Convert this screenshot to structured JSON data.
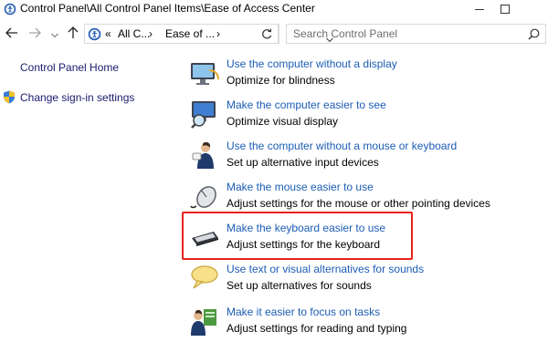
{
  "window": {
    "title": "Control Panel\\All Control Panel Items\\Ease of Access Center",
    "app_icon": "ease-of-access-icon"
  },
  "window_controls": {
    "minimize_icon": "minimize-icon",
    "maximize_icon": "maximize-icon"
  },
  "nav": {
    "back_icon": "back-arrow-icon",
    "forward_icon": "forward-arrow-icon",
    "up_icon": "up-arrow-icon"
  },
  "address": {
    "prefix": "«",
    "segments": [
      "All C...",
      "Ease of ..."
    ],
    "refresh_icon": "refresh-icon"
  },
  "search": {
    "placeholder": "Search Control Panel"
  },
  "sidebar": {
    "home_label": "Control Panel Home",
    "signin_label": "Change sign-in settings"
  },
  "items": [
    {
      "link": "Use the computer without a display",
      "desc": "Optimize for blindness",
      "icon": "display-narrator-icon"
    },
    {
      "link": "Make the computer easier to see",
      "desc": "Optimize visual display",
      "icon": "monitor-magnifier-icon"
    },
    {
      "link": "Use the computer without a mouse or keyboard",
      "desc": "Set up alternative input devices",
      "icon": "person-speech-icon"
    },
    {
      "link": "Make the mouse easier to use",
      "desc": "Adjust settings for the mouse or other pointing devices",
      "icon": "mouse-icon"
    },
    {
      "link": "Make the keyboard easier to use",
      "desc": "Adjust settings for the keyboard",
      "icon": "keyboard-icon"
    },
    {
      "link": "Use text or visual alternatives for sounds",
      "desc": "Set up alternatives for sounds",
      "icon": "speech-bubble-icon"
    },
    {
      "link": "Make it easier to focus on tasks",
      "desc": "Adjust settings for reading and typing",
      "icon": "person-document-icon"
    }
  ],
  "colors": {
    "link": "#1c5db5",
    "highlight": "#e8221a"
  }
}
